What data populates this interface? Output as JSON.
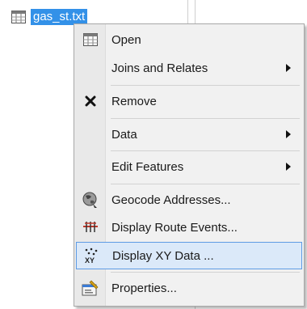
{
  "tree": {
    "layer_label": "gas_st.txt",
    "icon": "table-icon"
  },
  "menu": {
    "items": [
      {
        "label": "Open",
        "icon": "table-icon",
        "submenu": false
      },
      {
        "label": "Joins and Relates",
        "icon": "",
        "submenu": true
      },
      {
        "label": "Remove",
        "icon": "remove-x-icon",
        "submenu": false
      },
      {
        "label": "Data",
        "icon": "",
        "submenu": true
      },
      {
        "label": "Edit Features",
        "icon": "",
        "submenu": true
      },
      {
        "label": "Geocode Addresses...",
        "icon": "geocode-globe-icon",
        "submenu": false
      },
      {
        "label": "Display Route Events...",
        "icon": "route-events-icon",
        "submenu": false
      },
      {
        "label": "Display XY Data ...",
        "icon": "xy-data-icon",
        "submenu": false,
        "highlighted": true
      },
      {
        "label": "Properties...",
        "icon": "properties-icon",
        "submenu": false
      }
    ]
  },
  "colors": {
    "selection_bg": "#3391e8",
    "highlight_bg": "#dbe9f9",
    "highlight_border": "#5d9be4",
    "menu_bg": "#f1f1f1"
  }
}
